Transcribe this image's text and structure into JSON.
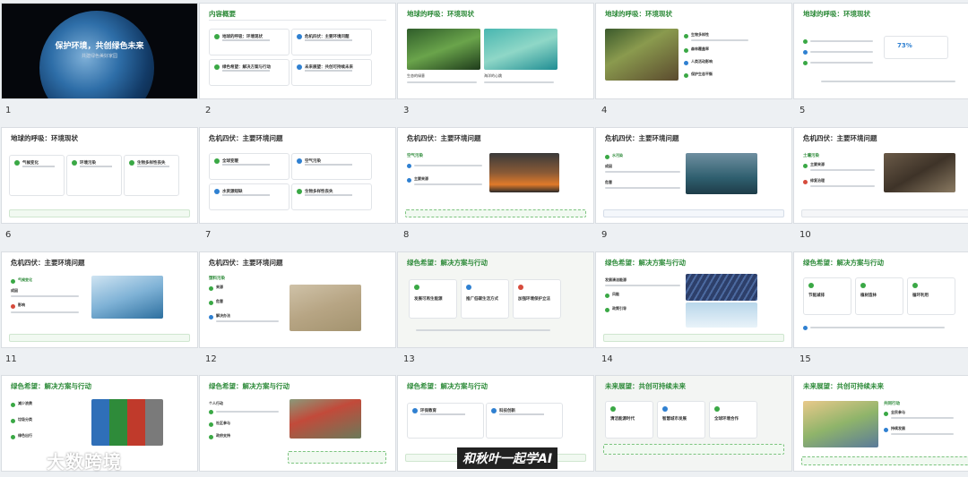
{
  "deck": {
    "slides": [
      {
        "n": "1",
        "title": "保护环境，共创绿色未来",
        "subtitle": "共建绿色美好家园"
      },
      {
        "n": "2",
        "title": "内容概要",
        "cards": [
          "地球的呼吸：环境现状",
          "危机四伏：主要环境问题",
          "绿色希望：解决方案与行动",
          "未来展望：共创可持续未来"
        ]
      },
      {
        "n": "3",
        "title": "地球的呼吸：环境现状",
        "caps": [
          "生态的绿意",
          "海洋的心跳"
        ]
      },
      {
        "n": "4",
        "title": "地球的呼吸：环境现状",
        "items": [
          "生物多样性",
          "森林覆盖率",
          "人类活动影响",
          "保护生态平衡"
        ]
      },
      {
        "n": "5",
        "title": "地球的呼吸：环境现状",
        "stat": "73%"
      },
      {
        "n": "6",
        "title": "地球的呼吸：环境现状",
        "cards": [
          "气候变化",
          "环境污染",
          "生物多样性丧失"
        ]
      },
      {
        "n": "7",
        "title": "危机四伏：主要环境问题",
        "cards": [
          "全球变暖",
          "空气污染",
          "水资源短缺",
          "生物多样性丧失"
        ]
      },
      {
        "n": "8",
        "title": "危机四伏：主要环境问题",
        "items": [
          "空气污染",
          "主要来源"
        ]
      },
      {
        "n": "9",
        "title": "危机四伏：主要环境问题",
        "items": [
          "水污染",
          "成因",
          "危害"
        ]
      },
      {
        "n": "10",
        "title": "危机四伏：主要环境问题",
        "items": [
          "土壤污染",
          "主要来源",
          "修复治理"
        ]
      },
      {
        "n": "11",
        "title": "危机四伏：主要环境问题",
        "items": [
          "气候变化",
          "成因",
          "影响"
        ]
      },
      {
        "n": "12",
        "title": "危机四伏：主要环境问题",
        "items": [
          "塑料污染",
          "来源",
          "危害",
          "解决办法"
        ]
      },
      {
        "n": "13",
        "title": "绿色希望：解决方案与行动",
        "cards": [
          "发展可再生能源",
          "推广低碳生活方式",
          "加强环境保护立法"
        ]
      },
      {
        "n": "14",
        "title": "绿色希望：解决方案与行动",
        "items": [
          "发展清洁能源",
          "风能",
          "政策引导"
        ]
      },
      {
        "n": "15",
        "title": "绿色希望：解决方案与行动",
        "cards": [
          "节能减排",
          "植树造林",
          "循环利用"
        ]
      },
      {
        "n": "16",
        "title": "绿色希望：解决方案与行动",
        "items": [
          "减少浪费",
          "垃圾分类",
          "绿色出行"
        ]
      },
      {
        "n": "17",
        "title": "绿色希望：解决方案与行动",
        "items": [
          "个人行动",
          "社区参与",
          "政府支持"
        ]
      },
      {
        "n": "18",
        "title": "绿色希望：解决方案与行动",
        "cards": [
          "环保教育",
          "科技创新"
        ]
      },
      {
        "n": "19",
        "title": "未来展望：共创可持续未来",
        "cards": [
          "清洁能源时代",
          "智慧城市发展",
          "全球环境合作"
        ]
      },
      {
        "n": "20",
        "title": "未来展望：共创可持续未来",
        "items": [
          "共同行动",
          "全民参与",
          "持续发展"
        ]
      }
    ]
  },
  "watermark": {
    "brand": "大数跨境",
    "badge": "和秋叶一起学AI"
  },
  "colors": {
    "accent": "#2e8b3a",
    "blue": "#2f80d1",
    "red": "#d64b3c",
    "bg": "#edf0f3"
  }
}
